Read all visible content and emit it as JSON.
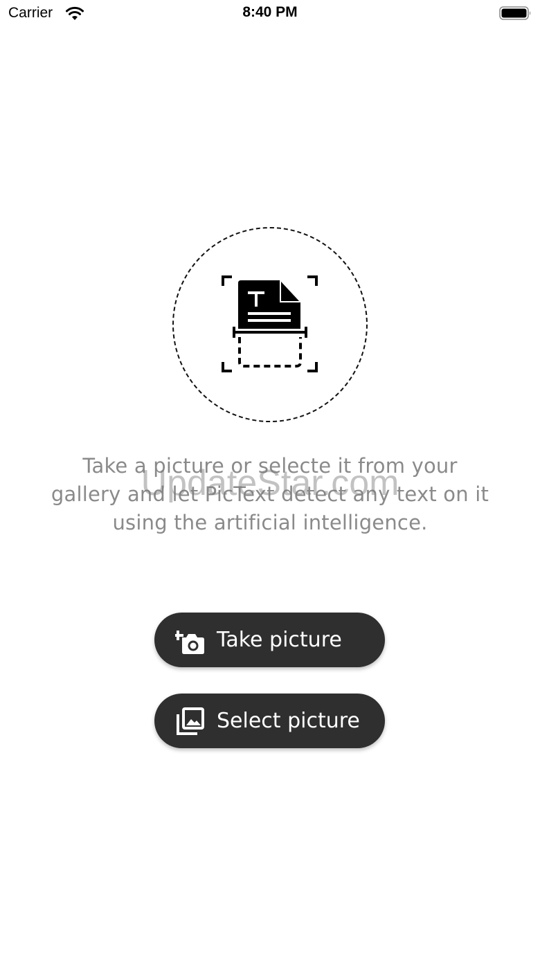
{
  "status_bar": {
    "carrier": "Carrier",
    "time": "8:40 PM",
    "wifi_icon": "wifi-icon",
    "battery_icon": "battery-icon"
  },
  "hero": {
    "icon": "document-scan-icon"
  },
  "description": "Take a picture or selecte it from your gallery and let PicText detect any text on it using the artificial intelligence.",
  "watermark": "UpdateStar.com",
  "actions": {
    "take_picture": {
      "label": "Take picture",
      "icon": "add-camera-icon"
    },
    "select_picture": {
      "label": "Select picture",
      "icon": "photo-library-icon"
    }
  },
  "colors": {
    "button_bg": "#2f2f2f",
    "button_text": "#ffffff",
    "description_text": "#8a8a8a"
  }
}
